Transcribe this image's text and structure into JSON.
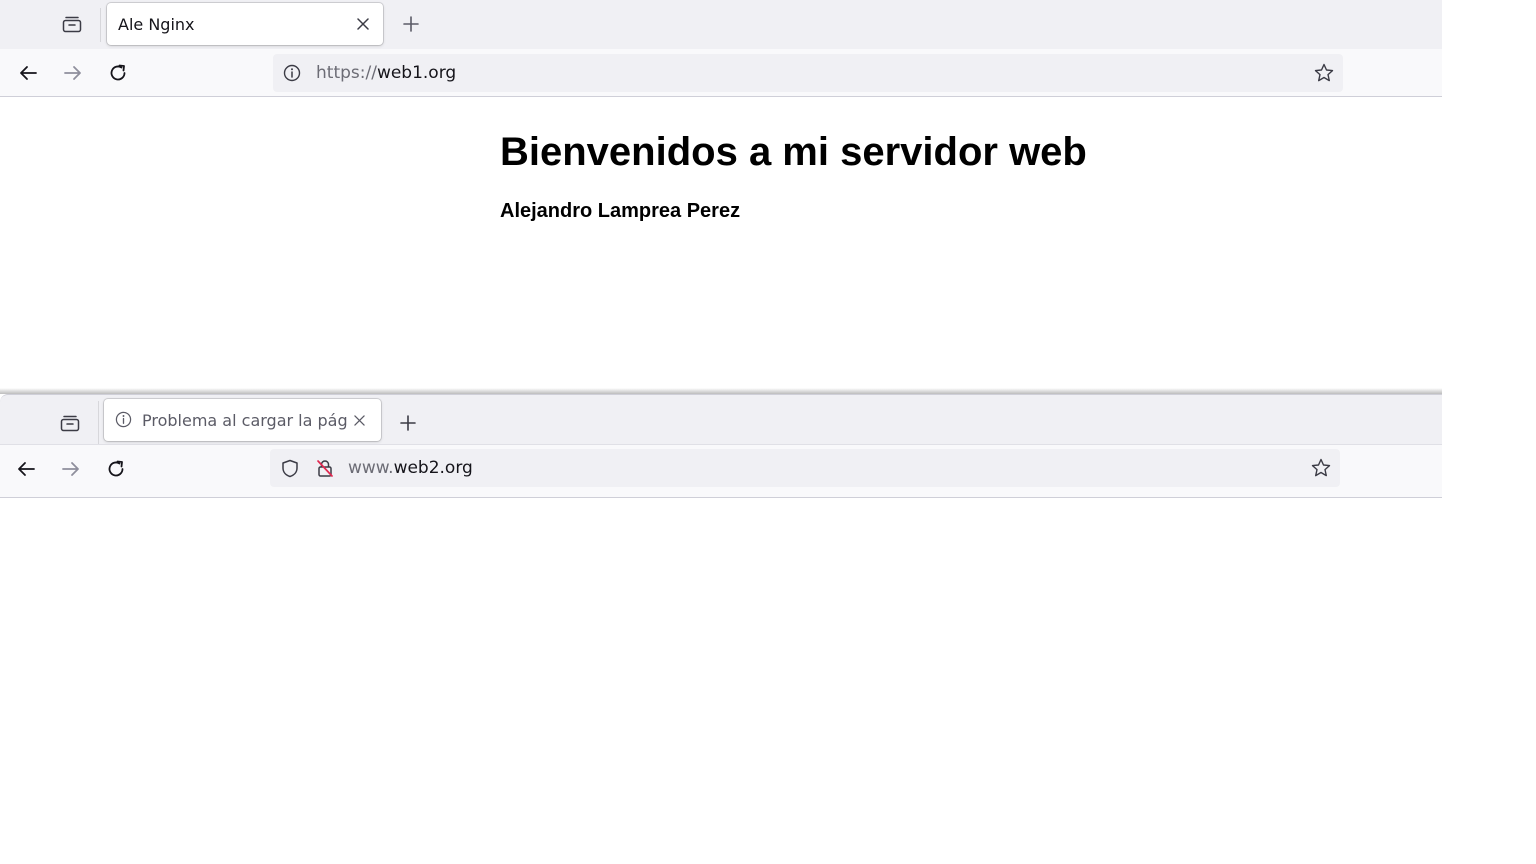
{
  "window1": {
    "tab": {
      "title": "Ale Nginx"
    },
    "urlbar": {
      "prefix": "https://",
      "domain": "web1.org",
      "suffix": ""
    },
    "page": {
      "heading": "Bienvenidos a mi servidor web",
      "subheading": "Alejandro Lamprea Perez"
    },
    "icons": [
      "tablist-icon",
      "close-icon",
      "plus-icon",
      "back-arrow-icon",
      "forward-arrow-icon",
      "reload-icon",
      "info-icon",
      "star-icon"
    ]
  },
  "window2": {
    "tab": {
      "title": "Problema al cargar la pág"
    },
    "urlbar": {
      "prefix": "www.",
      "domain": "web2.org",
      "suffix": ""
    },
    "icons": [
      "tablist-icon",
      "info-icon",
      "close-icon",
      "plus-icon",
      "back-arrow-icon",
      "forward-arrow-icon",
      "reload-icon",
      "shield-icon",
      "insecure-lock-icon",
      "star-icon"
    ]
  },
  "colors": {
    "tabstrip": "#f0f0f4",
    "toolbar": "#f9f9fb",
    "urlbar": "#f0f0f4",
    "text": "#15141a",
    "dim_text": "#6c6c75",
    "insecure_accent": "#e22850"
  }
}
